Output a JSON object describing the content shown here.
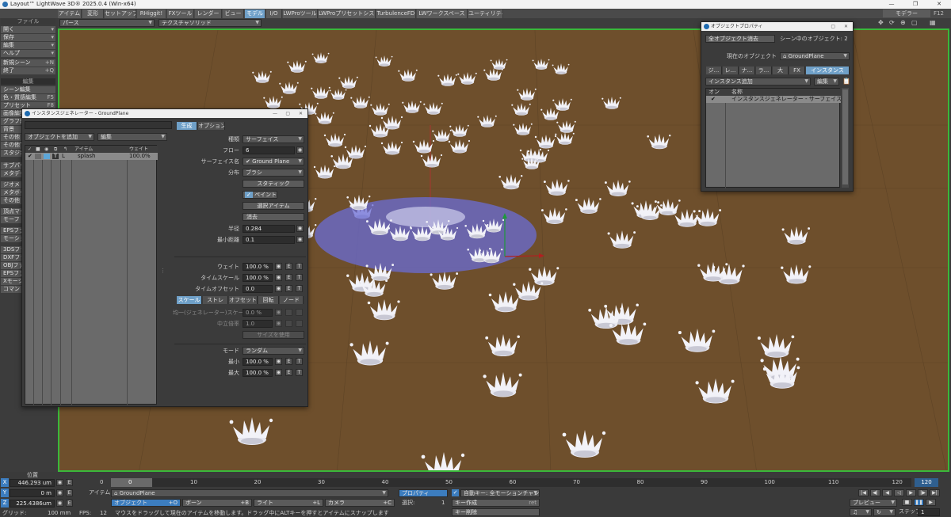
{
  "app": {
    "title": "Layout™ LightWave 3D® 2025.0.4 (Win-x64)"
  },
  "menu_tabs": [
    "アイテム",
    "変形",
    "セットアップ",
    "RHiggit!",
    "FXツール",
    "レンダー",
    "ビュー",
    "モデル",
    "I/O",
    "LWProツール",
    "LWProプリセットシステム",
    "TurbulenceFD",
    "LWワークスペース",
    "ユーティリティ"
  ],
  "menu_active": "モデル",
  "top_right": {
    "mode": "モデラー",
    "f12": "F12"
  },
  "viewbar": {
    "view": "パース",
    "render_mode": "テクスチャソリッド"
  },
  "sidebar": {
    "file": "ファイル",
    "items": [
      {
        "label": "開く",
        "key": "▾"
      },
      {
        "label": "保存",
        "key": "▾"
      },
      {
        "label": "編集",
        "key": "▾"
      },
      {
        "label": "ヘルプ",
        "key": "▾"
      },
      {
        "label": "新規シーン",
        "key": "+N"
      },
      {
        "label": "終了",
        "key": "+Q"
      }
    ],
    "edit_header": "編集",
    "edit_items": [
      {
        "label": "シーン編集",
        "key": ""
      },
      {
        "label": "色・質感編集",
        "key": "F5"
      },
      {
        "label": "プリセット",
        "key": "F8"
      },
      {
        "label": "画像編集",
        "key": ""
      },
      {
        "label": "グラフ編",
        "key": ""
      },
      {
        "label": "背景",
        "key": ""
      },
      {
        "label": "その他",
        "key": ""
      },
      {
        "label": "その他で",
        "key": ""
      },
      {
        "label": "スタジオ",
        "key": ""
      }
    ],
    "more_items": [
      "サブパッ",
      "メタデータ",
      "",
      "ジオメトリ",
      "メタボール",
      "その他",
      "",
      "頂点マッ",
      "モーフ",
      "",
      "EPSファ",
      "モーションデ",
      "",
      "3DSファ",
      "DXFファ",
      "OBJファ",
      "EPSファ",
      "Xモーション",
      "コマンド"
    ]
  },
  "instance_gen": {
    "title": "インスタンスジェネレーター - GroundPlane",
    "add_object": "オブジェクトを追加",
    "edit": "編集",
    "col_item": "アイテム",
    "col_weight": "ウェイト",
    "rows": [
      {
        "name": "splash",
        "type": "L",
        "weight": "100.0%"
      }
    ],
    "tabs": [
      "生成",
      "オプション"
    ],
    "type_label": "種類",
    "type_value": "サーフェイス",
    "flow_label": "フロー",
    "flow_value": "6",
    "surface_label": "サーフェイス名",
    "surface_value": "Ground Plane",
    "dist_label": "分布",
    "dist_value": "ブラシ",
    "static_btn": "スタティック",
    "paint_btn": "ペイント",
    "select_btn": "選択アイテム",
    "erase_btn": "消去",
    "radius_label": "半径",
    "radius_value": "0.284",
    "mindist_label": "最小距離",
    "mindist_value": "0.1",
    "weight_label": "ウェイト",
    "weight_value": "100.0 %",
    "timescale_label": "タイムスケール",
    "timescale_value": "100.0 %",
    "timeoffset_label": "タイムオフセット",
    "timeoffset_value": "0.0",
    "subtabs": [
      "スケール",
      "ストレ",
      "オフセット",
      "回転",
      "ノード"
    ],
    "uniform_label": "均一(ジェネレーター)スケール",
    "uniform_value": "0.0 %",
    "center_label": "中立倍率",
    "center_value": "1.0",
    "size_btn": "サイズを使用",
    "mode_label": "モード",
    "mode_value": "ランダム",
    "min_label": "最小",
    "min_value": "100.0 %",
    "max_label": "最大",
    "max_value": "100.0 %"
  },
  "obj_props": {
    "title": "オブジェクトプロパティ",
    "clear_all": "全オブジェクト消去",
    "scene_count": "シーン中のオブジェクト: 2",
    "current_label": "現在のオブジェクト",
    "current_value": "GroundPlane",
    "tabs": [
      "ジ...",
      "レ...",
      "ナ...",
      "ラ...",
      "大",
      "FX",
      "インスタンス"
    ],
    "add_instance": "インスタンス追加",
    "edit": "編集",
    "col_on": "オン",
    "col_name": "名称",
    "rows": [
      {
        "name": "インスタンスジェネレーター - サーフェイス 83 インス"
      }
    ]
  },
  "bottom": {
    "position_label": "位置",
    "x_label": "X",
    "x_value": "446.293 um",
    "y_label": "Y",
    "y_value": "0 m",
    "z_label": "Z",
    "z_value": "225.4386um",
    "grid_label": "グリッド:",
    "grid_value": "100 mm",
    "e": "E",
    "timeline_start": "0",
    "timeline_current": "0",
    "ticks": [
      "10",
      "20",
      "30",
      "40",
      "50",
      "60",
      "70",
      "80",
      "90",
      "100",
      "110",
      "120"
    ],
    "timeline_end": "120",
    "item_label": "アイテム",
    "item_value": "GroundPlane",
    "properties_btn": "プロパティ",
    "buttons": [
      {
        "label": "オブジェクト",
        "key": "+O"
      },
      {
        "label": "ボーン",
        "key": "+B"
      },
      {
        "label": "ライト",
        "key": "+L"
      },
      {
        "label": "カメラ",
        "key": "+C"
      }
    ],
    "selected_label": "選択:",
    "selected_value": "1",
    "autokey_label": "自動キー: 全モーションチャンネル",
    "create_key": "キー作成",
    "create_key_key": "ret",
    "delete_key": "キー削除",
    "fps_label": "FPS:",
    "fps_value": "12",
    "status": "マウスをドラッグして現在のアイテムを移動します。ドラッグ中にALTキーを押すとアイテムにスナップします",
    "preview": "プレビュー",
    "step_label": "ステップ",
    "step_value": "1"
  },
  "colors": {
    "ground": "#6e4f2c",
    "accent": "#6fa0c8",
    "viewport_border": "#3ab83a",
    "brush": "#6b6cd6"
  }
}
